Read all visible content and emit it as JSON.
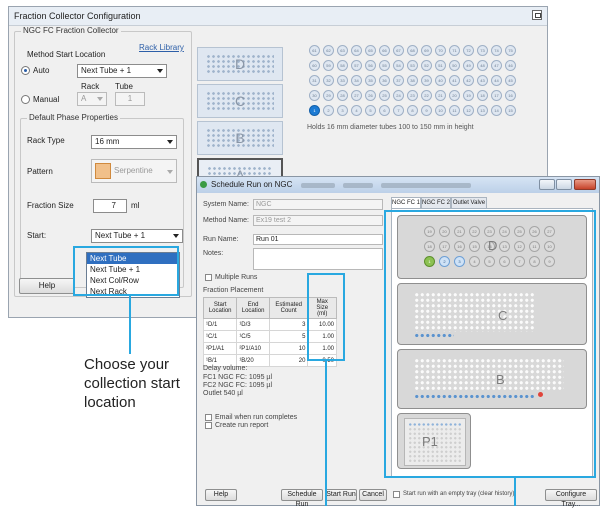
{
  "win1": {
    "title": "Fraction Collector Configuration",
    "group_title": "NGC FC Fraction Collector",
    "method_start_label": "Method Start Location",
    "rack_library_link": "Rack Library",
    "auto_label": "Auto",
    "auto_value": "Next Tube + 1",
    "manual_label": "Manual",
    "rack_col_label": "Rack",
    "tube_col_label": "Tube",
    "manual_rack_value": "A",
    "manual_tube_value": "1",
    "phase_group_title": "Default Phase Properties",
    "rack_type_label": "Rack Type",
    "rack_type_value": "16 mm",
    "pattern_label": "Pattern",
    "pattern_value": "Serpentine",
    "fraction_size_label": "Fraction Size",
    "fraction_size_value": "7",
    "fraction_size_unit": "ml",
    "start_label": "Start:",
    "start_value": "Next Tube + 1",
    "start_options": [
      "Next Tube",
      "Next Tube + 1",
      "Next Col/Row",
      "Next Rack"
    ],
    "start_selected_index": 0,
    "help_button": "Help",
    "racks": [
      "D",
      "C",
      "B",
      "A"
    ],
    "selected_rack": "A",
    "tube_rows": [
      [
        "61",
        "62",
        "63",
        "64",
        "65",
        "66",
        "67",
        "68",
        "69",
        "70",
        "71",
        "72",
        "73",
        "74",
        "75"
      ],
      [
        "60",
        "59",
        "58",
        "57",
        "56",
        "55",
        "54",
        "53",
        "52",
        "51",
        "50",
        "49",
        "48",
        "47",
        "46"
      ],
      [
        "31",
        "32",
        "33",
        "34",
        "35",
        "36",
        "37",
        "38",
        "39",
        "40",
        "41",
        "42",
        "43",
        "44",
        "45"
      ],
      [
        "30",
        "29",
        "28",
        "27",
        "26",
        "25",
        "24",
        "23",
        "22",
        "21",
        "20",
        "19",
        "18",
        "17",
        "16"
      ],
      [
        "1",
        "2",
        "3",
        "4",
        "5",
        "6",
        "7",
        "8",
        "9",
        "10",
        "11",
        "12",
        "13",
        "14",
        "15"
      ]
    ],
    "rack_description": "Holds 16 mm diameter tubes 100 to 150 mm in height"
  },
  "win2": {
    "title": "Schedule Run on NGC",
    "system_name_label": "System Name:",
    "system_name_value": "NGC",
    "method_name_label": "Method Name:",
    "method_name_value": "Ex19 test 2",
    "run_name_label": "Run Name:",
    "run_name_value": "Run 01",
    "notes_label": "Notes:",
    "multiple_runs_label": "Multiple Runs",
    "fraction_placement_label": "Fraction Placement",
    "table_headers": [
      "Start Location",
      "End Location",
      "Estimated Count",
      "Max Size (ml)"
    ],
    "table_rows": [
      [
        "¹D/1",
        "¹D/3",
        "3",
        "10.00"
      ],
      [
        "¹C/1",
        "¹C/5",
        "5",
        "1.00"
      ],
      [
        "²P1/A1",
        "²P1/A10",
        "10",
        "1.00"
      ],
      [
        "¹B/1",
        "¹B/20",
        "20",
        "0.50"
      ]
    ],
    "delay_volume_label": "Delay volume:",
    "delay_lines": [
      "FC1 NGC FC: 1095 µl",
      "FC2 NGC FC: 1095 µl",
      "Outlet 540 µl"
    ],
    "email_label": "Email when run completes",
    "report_label": "Create run report",
    "tabs": [
      "NGC FC 1",
      "NGC FC 2",
      "Outlet Valve"
    ],
    "rack_d_label": "D",
    "rack_c_label": "C",
    "rack_b_label": "B",
    "rack_p1_label": "P1",
    "rack_d_rows": [
      [
        "19",
        "20",
        "21",
        "22",
        "23",
        "24",
        "25",
        "26",
        "27"
      ],
      [
        "18",
        "17",
        "16",
        "15",
        "14",
        "13",
        "12",
        "11",
        "10"
      ],
      [
        "1",
        "2",
        "3",
        "4",
        "5",
        "6",
        "7",
        "8",
        "9"
      ]
    ],
    "help_button": "Help",
    "schedule_run_button": "Schedule Run",
    "start_run_button": "Start Run",
    "cancel_button": "Cancel",
    "empty_tray_label": "Start run with an empty tray (clear history)",
    "configure_tray_button": "Configure Tray..."
  },
  "caption": "Choose your collection start location",
  "colors": {
    "callout": "#29a8e0",
    "selected_tube": "#1d7bd4",
    "green_tube": "#8cc152"
  }
}
